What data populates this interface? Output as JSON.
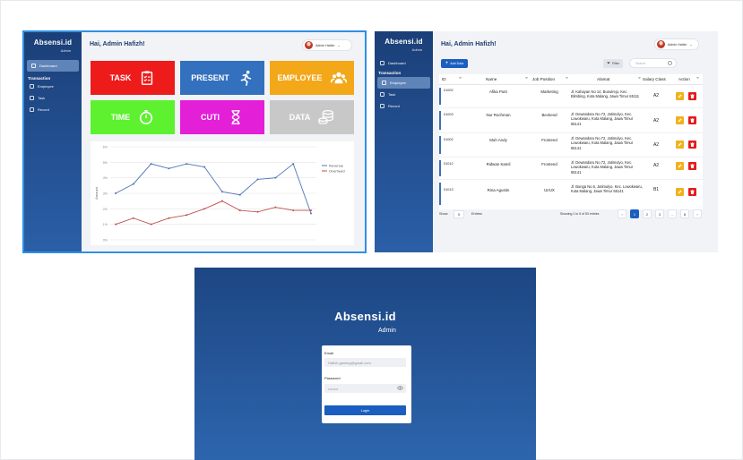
{
  "sidebar": {
    "brand": "Absensi.id",
    "brand_sub": "Admin",
    "dashboard": "Dashboard",
    "section": "Transaction",
    "employee": "Employee",
    "task": "Task",
    "record": "Record"
  },
  "dashboard": {
    "greeting": "Hai, Admin Hafizh!",
    "user": "Admin Hafizh",
    "tiles": {
      "task": "TASK",
      "present": "PRESENT",
      "employee": "EMPLOYEE",
      "time": "TIME",
      "cuti": "CUTI",
      "data": "DATA"
    },
    "colors": {
      "task": "#ee1b1b",
      "present": "#3370bd",
      "employee": "#f3a81a",
      "time": "#5df12f",
      "cuti": "#e31fd8",
      "data": "#c8c8c8"
    }
  },
  "chart_data": {
    "type": "line",
    "ylabel": "Amount",
    "y_ticks": [
      "0%",
      "1%",
      "2%",
      "3%",
      "4%",
      "5%",
      "6%"
    ],
    "ylim": [
      0,
      6
    ],
    "series": [
      {
        "name": "Revenue",
        "color": "#4e74b4",
        "values": [
          3.0,
          3.6,
          4.9,
          4.6,
          4.9,
          4.7,
          3.1,
          2.9,
          3.9,
          4.0,
          4.9,
          1.7
        ]
      },
      {
        "name": "Overhead",
        "color": "#c0504d",
        "values": [
          1.0,
          1.4,
          1.0,
          1.4,
          1.6,
          2.0,
          2.5,
          1.9,
          1.8,
          2.1,
          1.9,
          1.9
        ]
      }
    ],
    "legend_position": "right",
    "grid": true
  },
  "employees": {
    "greeting": "Hai, Admin Hafizh!",
    "user": "Admin Hafizh",
    "add_label": "Add Data",
    "filter_label": "Filter",
    "search_placeholder": "Search",
    "columns": [
      "ID",
      "Name",
      "Job Position",
      "Alamat",
      "Salary Class",
      "Action"
    ],
    "rows": [
      {
        "id": "01002",
        "name": "Afika Putri",
        "position": "Marketing",
        "address": "Jl. Kahayan No 14, Bunulrejo, Kec. Blimbing, Kota Malang, Jawa Timur 65111",
        "salary": "A2"
      },
      {
        "id": "01003",
        "name": "Nur Rochman",
        "position": "Beckend",
        "address": "Jl. Dewandaru No.72, Jatimulyo, Kec. Lowokwaru, Kota Malang, Jawa Timur 65141",
        "salary": "A2"
      },
      {
        "id": "01002",
        "name": "Muh Andy",
        "position": "Frontend",
        "address": "Jl. Dewandaru No.72, Jatimulyo, Kec. Lowokwaru, Kota Malang, Jawa Timur 65141",
        "salary": "A2"
      },
      {
        "id": "01012",
        "name": "Ridwan Kamil",
        "position": "Frontend",
        "address": "Jl. Dewandaru No.72, Jatimulyo, Kec. Lowokwaru, Kota Malang, Jawa Timur 65141",
        "salary": "A2"
      },
      {
        "id": "01013",
        "name": "Rina Agustin",
        "position": "UI/UX",
        "address": "Jl. Bunga No.6, Jatimulyo, Kec. Lowokwaru, Kota Malang, Jawa Timur 65141",
        "salary": "B1"
      }
    ],
    "show_label": "Show",
    "show_value": "5",
    "entries_label": "Entries",
    "showing_text": "Showing 1 to 5 of 50 entries",
    "pages": [
      "1",
      "2",
      "3",
      "...",
      "8"
    ],
    "prev": "‹",
    "next": "›"
  },
  "login": {
    "brand": "Absensi.id",
    "sub": "Admin",
    "email_label": "Email",
    "email_value": "Hafizh.gaming@gmail.com",
    "password_label": "Password",
    "password_value": "••••••••",
    "button": "Login"
  }
}
